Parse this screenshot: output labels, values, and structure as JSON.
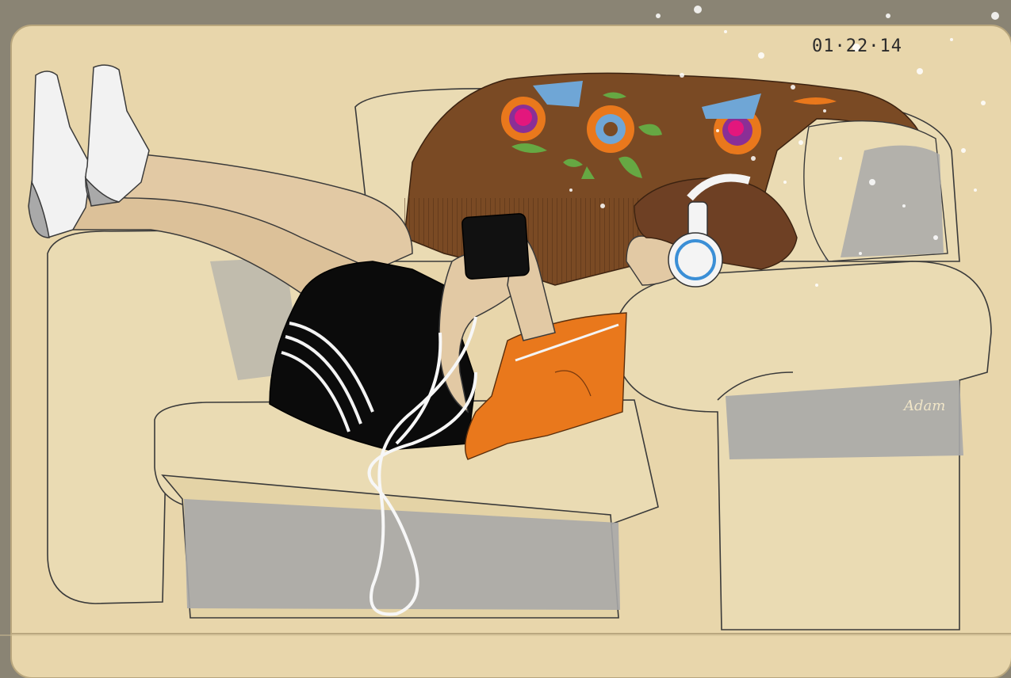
{
  "artwork": {
    "date_text": "01·22·14",
    "signature_text": "Adam"
  },
  "colors": {
    "paper": "#e8d6ab",
    "sofa_shadow": "#a8a8a8",
    "shorts": "#0b0b0b",
    "shirt": "#e9781c",
    "blanket": "#7a4a24",
    "hair": "#6e4024",
    "skin": "#e2c9a4",
    "sock": "#f2f2f2",
    "flower_pink": "#e3177d",
    "flower_purple": "#8a2f96",
    "flower_orange": "#e9781c",
    "leaf_green": "#66a843",
    "patch_blue": "#6fa6d6"
  },
  "scene_objects": [
    "sketchbook-page",
    "armchair",
    "brown-knit-blanket",
    "person-reclining",
    "black-shorts",
    "orange-shirt",
    "smartphone",
    "white-headphones",
    "earphone-cable",
    "white-socks",
    "paint-splatter"
  ]
}
